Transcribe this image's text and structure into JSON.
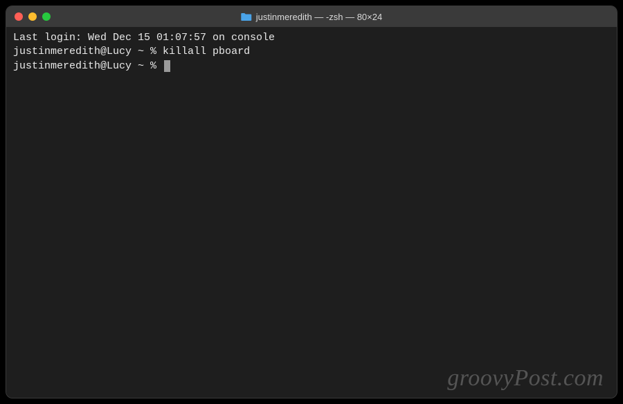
{
  "titlebar": {
    "title": "justinmeredith — -zsh — 80×24",
    "icon": "folder-icon"
  },
  "terminal": {
    "lines": [
      {
        "text": "Last login: Wed Dec 15 01:07:57 on console"
      },
      {
        "prompt": "justinmeredith@Lucy ~ % ",
        "command": "killall pboard"
      },
      {
        "prompt": "justinmeredith@Lucy ~ % ",
        "command": "",
        "cursor": true
      }
    ]
  },
  "watermark": "groovyPost.com"
}
